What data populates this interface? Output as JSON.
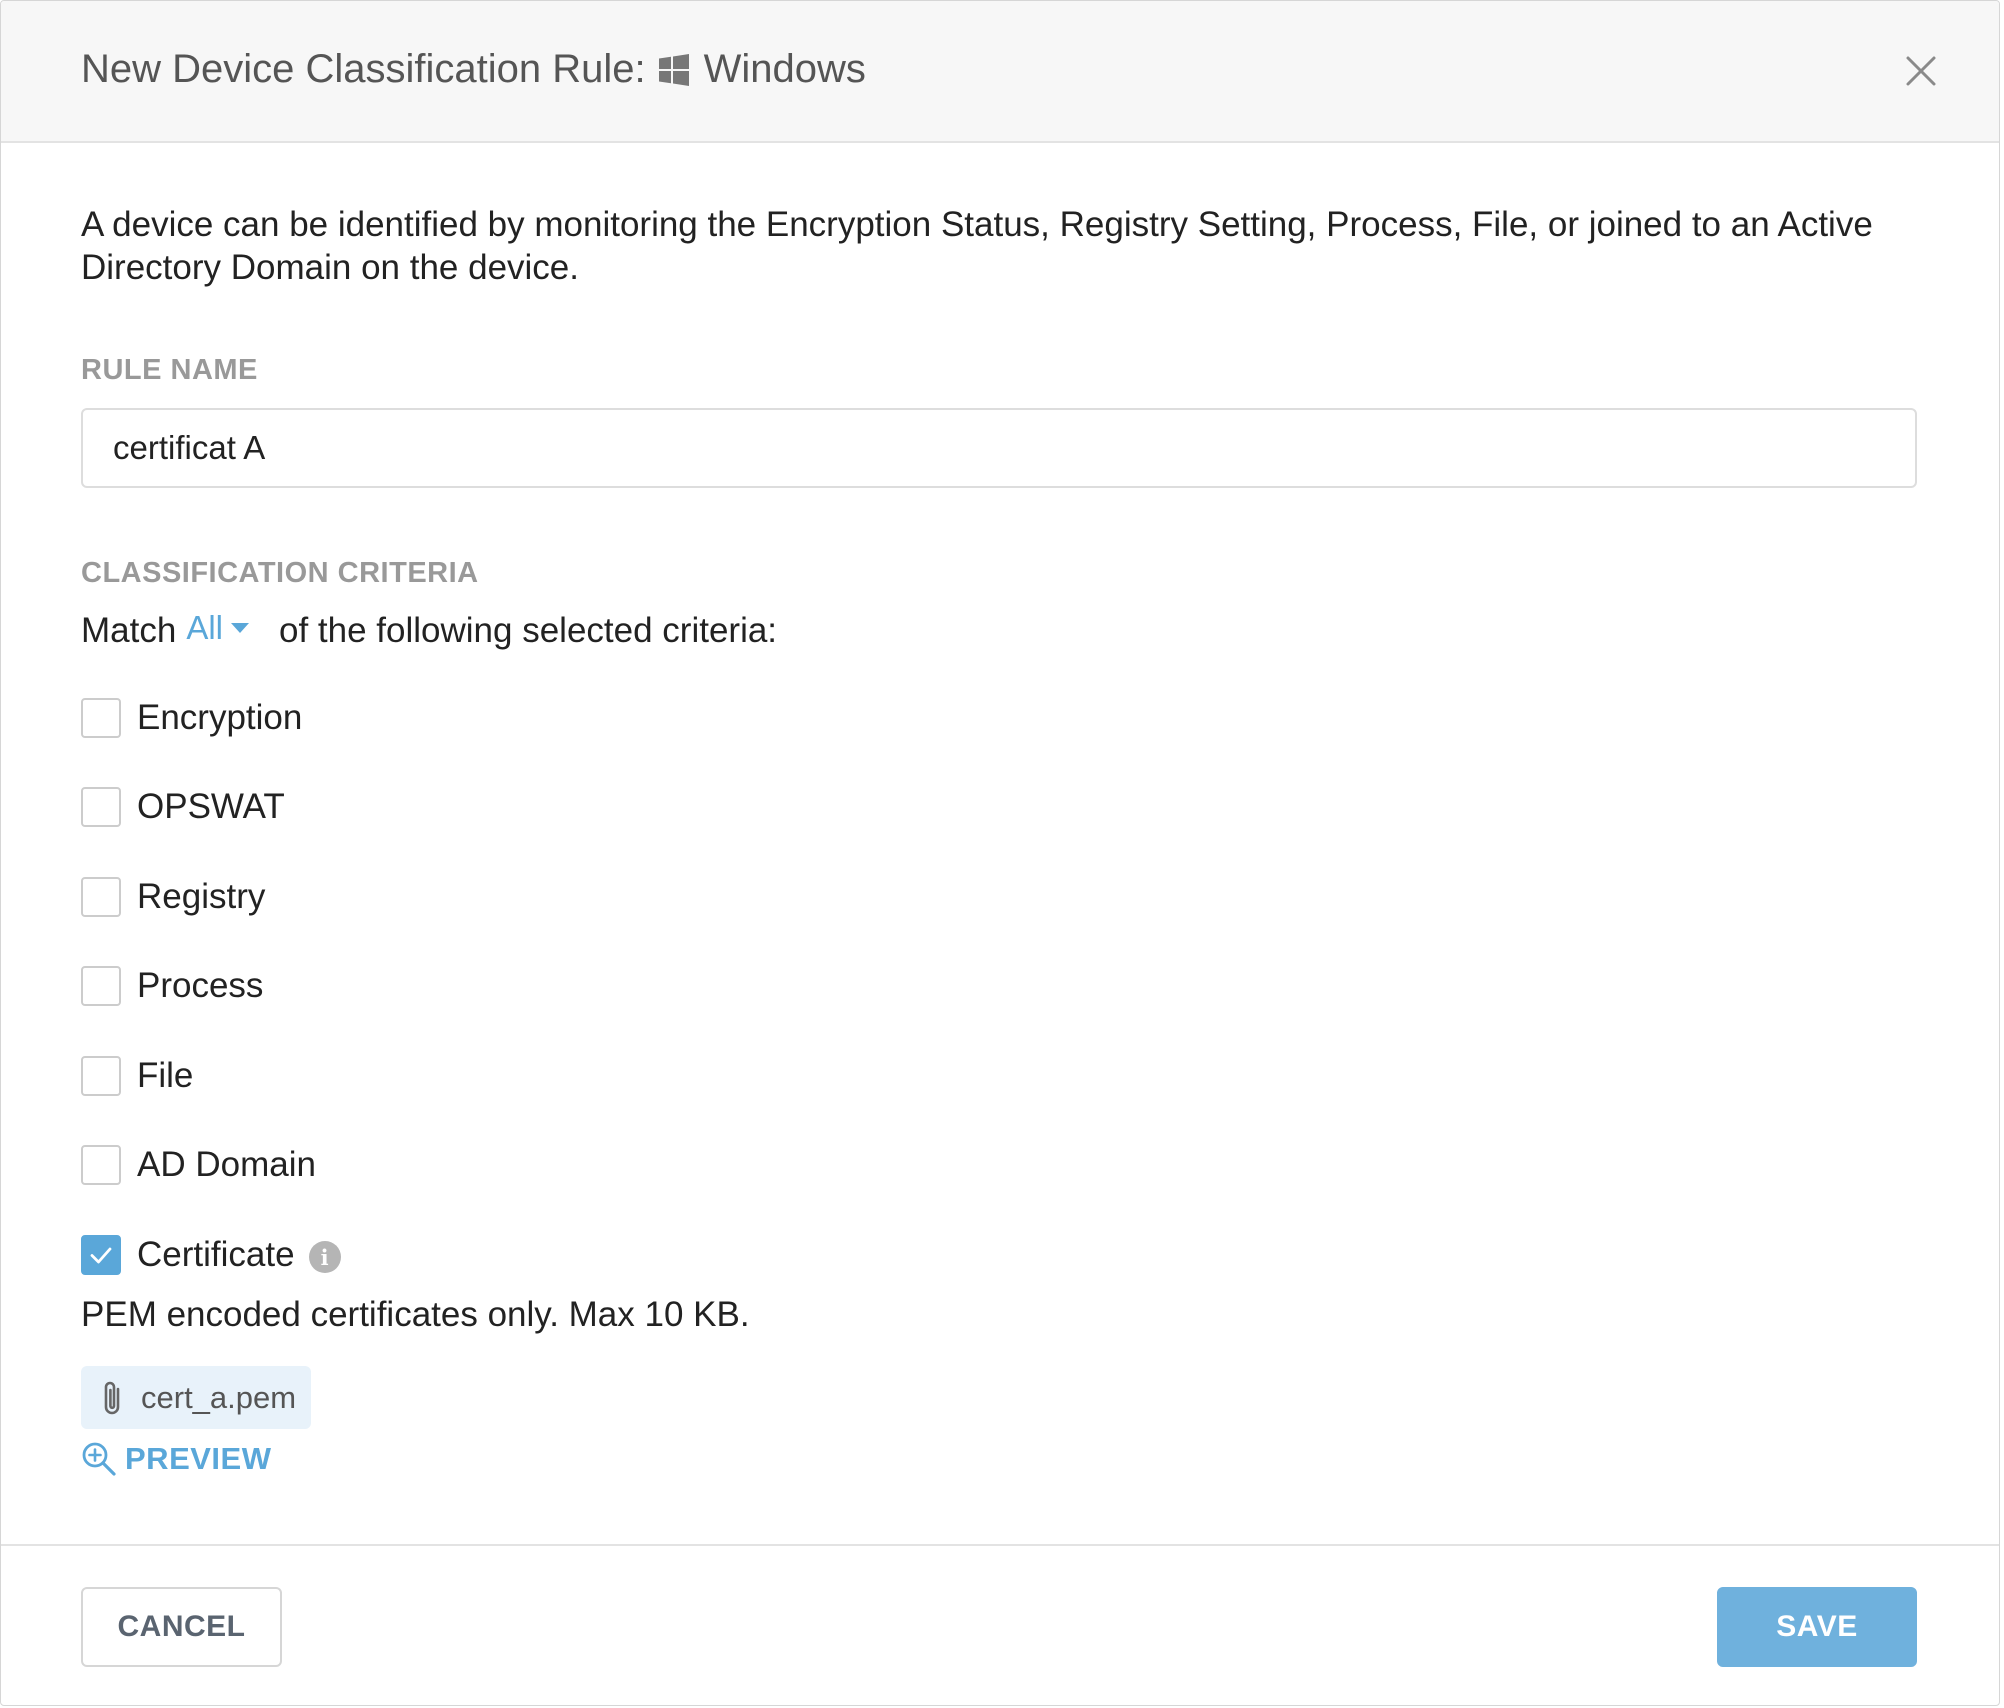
{
  "dialog": {
    "title_prefix": "New Device Classification Rule:",
    "platform": "Windows",
    "platform_icon": "windows-logo-icon",
    "close_icon": "close-icon"
  },
  "description": "A device can be identified by monitoring the Encryption Status, Registry Setting, Process, File, or joined to an Active Directory Domain on the device.",
  "rule_name": {
    "label": "RULE NAME",
    "value": "certificat A"
  },
  "criteria": {
    "label": "CLASSIFICATION CRITERIA",
    "match_prefix": "Match",
    "match_value": "All",
    "match_suffix": "of the following selected criteria:",
    "items": [
      {
        "label": "Encryption",
        "checked": false
      },
      {
        "label": "OPSWAT",
        "checked": false
      },
      {
        "label": "Registry",
        "checked": false
      },
      {
        "label": "Process",
        "checked": false
      },
      {
        "label": "File",
        "checked": false
      },
      {
        "label": "AD Domain",
        "checked": false
      },
      {
        "label": "Certificate",
        "checked": true
      }
    ],
    "certificate_info_glyph": "i",
    "certificate_hint": "PEM encoded certificates only. Max 10 KB.",
    "file_name": "cert_a.pem",
    "file_icon": "paperclip-icon",
    "preview_label": "PREVIEW",
    "preview_icon": "zoom-in-icon"
  },
  "footer": {
    "cancel_label": "CANCEL",
    "save_label": "SAVE"
  },
  "colors": {
    "accent": "#5aa7d9",
    "save_button": "#6fb1dd",
    "header_bg": "#f7f7f7",
    "chip_bg": "#e8f2fa",
    "section_label": "#999999"
  }
}
